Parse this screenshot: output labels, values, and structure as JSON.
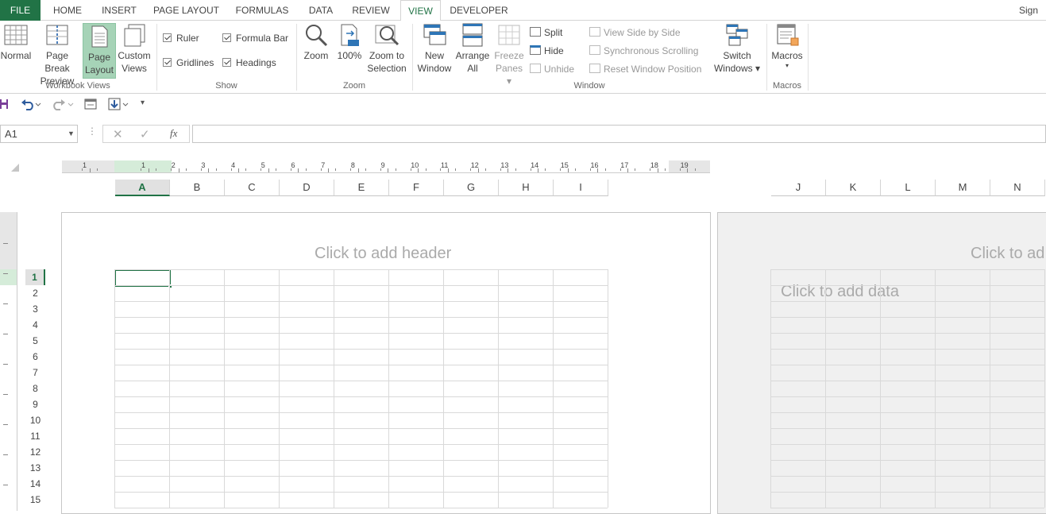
{
  "tabs": {
    "file": "FILE",
    "items": [
      "HOME",
      "INSERT",
      "PAGE LAYOUT",
      "FORMULAS",
      "DATA",
      "REVIEW",
      "VIEW",
      "DEVELOPER"
    ],
    "sign_in": "Sign"
  },
  "ribbon": {
    "workbook_views": {
      "label": "Workbook Views",
      "normal": [
        "Normal"
      ],
      "page_break": [
        "Page Break",
        "Preview"
      ],
      "page_layout": [
        "Page",
        "Layout"
      ],
      "custom_views": [
        "Custom",
        "Views"
      ]
    },
    "show": {
      "label": "Show",
      "ruler": "Ruler",
      "formula_bar": "Formula Bar",
      "gridlines": "Gridlines",
      "headings": "Headings"
    },
    "zoom": {
      "label": "Zoom",
      "zoom": [
        "Zoom"
      ],
      "pct": [
        "100%"
      ],
      "zoom_sel": [
        "Zoom to",
        "Selection"
      ]
    },
    "window": {
      "label": "Window",
      "new_window": [
        "New",
        "Window"
      ],
      "arrange_all": [
        "Arrange",
        "All"
      ],
      "freeze": [
        "Freeze",
        "Panes ▾"
      ],
      "split": "Split",
      "hide": "Hide",
      "unhide": "Unhide",
      "view_side": "View Side by Side",
      "sync_scroll": "Synchronous Scrolling",
      "reset_pos": "Reset Window Position",
      "switch": [
        "Switch",
        "Windows ▾"
      ]
    },
    "macros": {
      "label": "Macros",
      "macros": [
        "Macros",
        "▾"
      ]
    }
  },
  "qat": {
    "customize": "▾"
  },
  "formula_bar": {
    "name_box": "A1",
    "fx": "fx",
    "cancel": "✕",
    "enter": "✓",
    "value": ""
  },
  "sheet": {
    "ruler_numbers": [
      "1",
      "1",
      "2",
      "3",
      "4",
      "5",
      "6",
      "7",
      "8",
      "9",
      "10",
      "11",
      "12",
      "13",
      "14",
      "15",
      "16",
      "17",
      "18",
      "19"
    ],
    "columns_left": [
      "A",
      "B",
      "C",
      "D",
      "E",
      "F",
      "G",
      "H",
      "I"
    ],
    "columns_right": [
      "J",
      "K",
      "L",
      "M",
      "N"
    ],
    "rows": [
      "1",
      "2",
      "3",
      "4",
      "5",
      "6",
      "7",
      "8",
      "9",
      "10",
      "11",
      "12",
      "13",
      "14",
      "15"
    ],
    "header_placeholder": "Click to add header",
    "header_placeholder_right": "Click to ad",
    "data_placeholder": "Click to add data"
  },
  "colors": {
    "accent": "#217346",
    "selected_button": "#a6d3b7"
  }
}
